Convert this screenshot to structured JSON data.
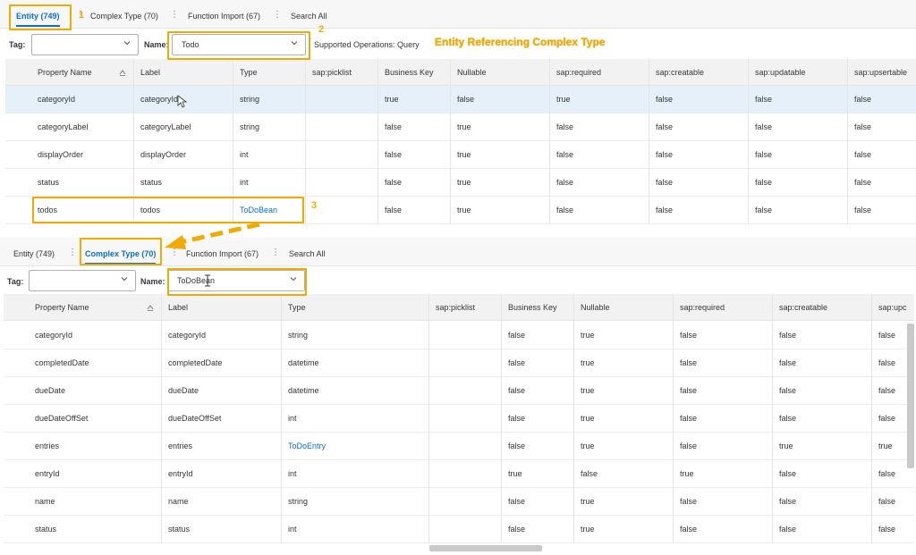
{
  "top": {
    "tabs": [
      {
        "label": "Entity (749)",
        "active": true
      },
      {
        "label": "Complex Type (70)",
        "active": false
      },
      {
        "label": "Function Import (67)",
        "active": false
      },
      {
        "label": "Search All",
        "active": false
      }
    ],
    "filter": {
      "tag_label": "Tag:",
      "tag_value": "",
      "name_label": "Name:",
      "name_value": "Todo",
      "ops": "Supported Operations: Query"
    },
    "columns": [
      "Property Name",
      "Label",
      "Type",
      "sap:picklist",
      "Business Key",
      "Nullable",
      "sap:required",
      "sap:creatable",
      "sap:updatable",
      "sap:upsertable"
    ],
    "rows": [
      [
        "categoryId",
        "categoryId",
        "string",
        "",
        "true",
        "false",
        "true",
        "false",
        "false",
        "false"
      ],
      [
        "categoryLabel",
        "categoryLabel",
        "string",
        "",
        "false",
        "true",
        "false",
        "false",
        "false",
        "false"
      ],
      [
        "displayOrder",
        "displayOrder",
        "int",
        "",
        "false",
        "true",
        "false",
        "false",
        "false",
        "false"
      ],
      [
        "status",
        "status",
        "int",
        "",
        "false",
        "true",
        "false",
        "false",
        "false",
        "false"
      ],
      [
        "todos",
        "todos",
        "ToDoBean",
        "",
        "false",
        "true",
        "false",
        "false",
        "false",
        "false"
      ]
    ]
  },
  "bottom": {
    "tabs": [
      {
        "label": "Entity (749)",
        "active": false
      },
      {
        "label": "Complex Type (70)",
        "active": true
      },
      {
        "label": "Function Import (67)",
        "active": false
      },
      {
        "label": "Search All",
        "active": false
      }
    ],
    "filter": {
      "tag_label": "Tag:",
      "tag_value": "",
      "name_label": "Name:",
      "name_value": "ToDoBean"
    },
    "columns": [
      "Property Name",
      "Label",
      "Type",
      "sap:picklist",
      "Business Key",
      "Nullable",
      "sap:required",
      "sap:creatable",
      "sap:upc"
    ],
    "rows": [
      [
        "categoryId",
        "categoryId",
        "string",
        "",
        "false",
        "true",
        "false",
        "false",
        "false"
      ],
      [
        "completedDate",
        "completedDate",
        "datetime",
        "",
        "false",
        "true",
        "false",
        "false",
        "false"
      ],
      [
        "dueDate",
        "dueDate",
        "datetime",
        "",
        "false",
        "true",
        "false",
        "false",
        "false"
      ],
      [
        "dueDateOffSet",
        "dueDateOffSet",
        "int",
        "",
        "false",
        "true",
        "false",
        "false",
        "false"
      ],
      [
        "entries",
        "entries",
        "ToDoEntry",
        "",
        "false",
        "true",
        "false",
        "true",
        "true"
      ],
      [
        "entryId",
        "entryId",
        "int",
        "",
        "true",
        "false",
        "true",
        "false",
        "false"
      ],
      [
        "name",
        "name",
        "string",
        "",
        "false",
        "true",
        "false",
        "false",
        "false"
      ],
      [
        "status",
        "status",
        "int",
        "",
        "false",
        "true",
        "false",
        "false",
        "false"
      ]
    ]
  },
  "annotations": {
    "n1": "1",
    "n2": "2",
    "n3": "3",
    "caption": "Entity Referencing Complex Type"
  },
  "colors": {
    "highlight": "#f0ab00",
    "link": "#0a6ed1",
    "selected_row": "#e5f0fa"
  }
}
